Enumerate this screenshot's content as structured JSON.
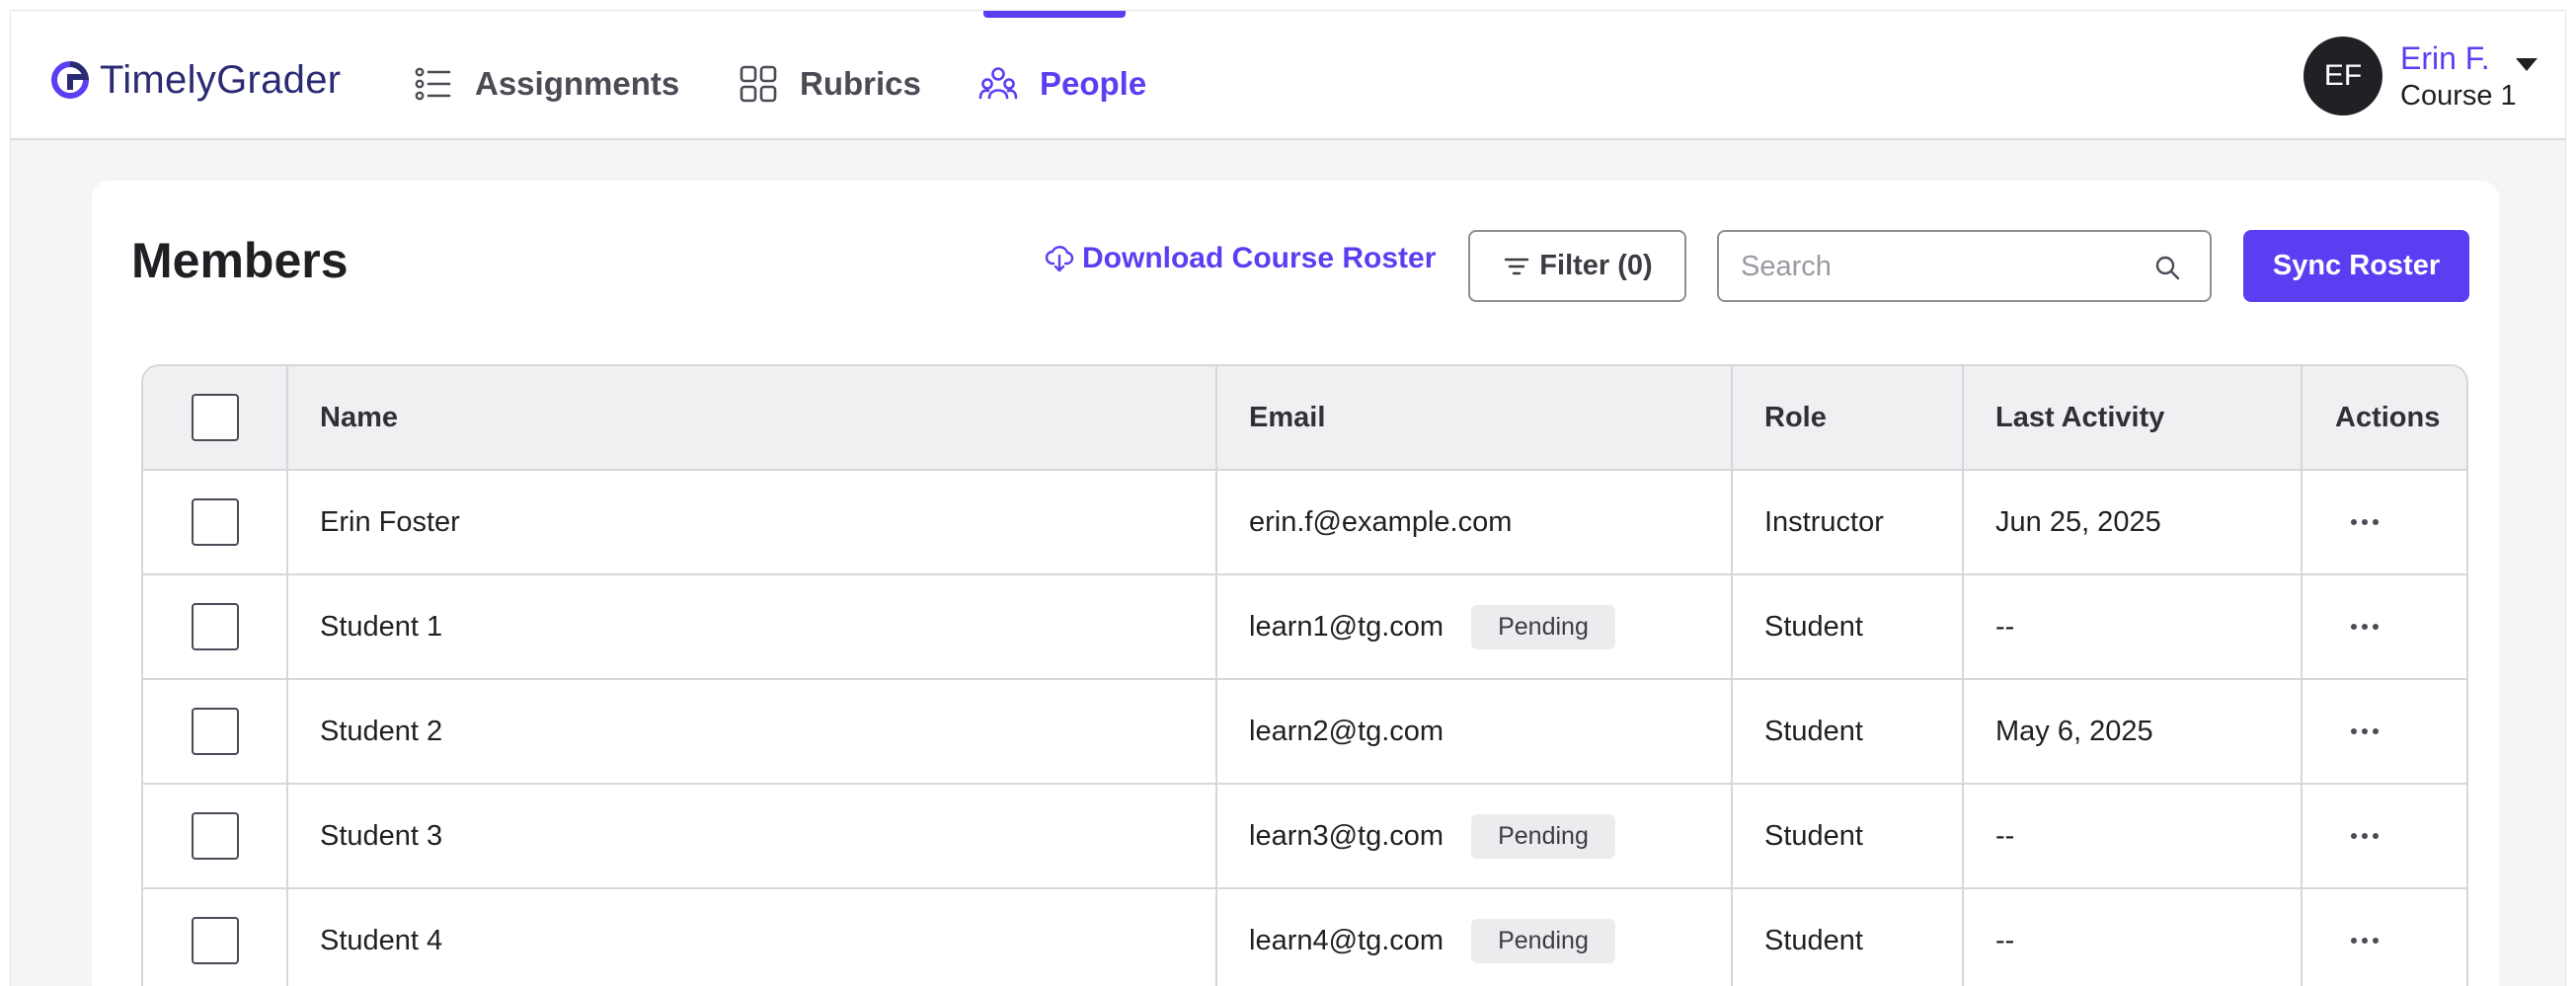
{
  "app": {
    "name": "TimelyGrader"
  },
  "nav": {
    "items": [
      {
        "label": "Assignments",
        "icon": "list-icon"
      },
      {
        "label": "Rubrics",
        "icon": "grid-icon"
      },
      {
        "label": "People",
        "icon": "people-icon",
        "active": true
      }
    ]
  },
  "user": {
    "initials": "EF",
    "name": "Erin F.",
    "course": "Course 1"
  },
  "members": {
    "title": "Members",
    "download_label": "Download Course Roster",
    "filter_label": "Filter (0)",
    "search_placeholder": "Search",
    "sync_label": "Sync Roster",
    "columns": [
      "Name",
      "Email",
      "Role",
      "Last Activity",
      "Actions"
    ],
    "rows": [
      {
        "name": "Erin Foster",
        "email": "erin.f@example.com",
        "badge": "",
        "role": "Instructor",
        "last_activity": "Jun 25, 2025"
      },
      {
        "name": "Student 1",
        "email": "learn1@tg.com",
        "badge": "Pending",
        "role": "Student",
        "last_activity": "--"
      },
      {
        "name": "Student 2",
        "email": "learn2@tg.com",
        "badge": "",
        "role": "Student",
        "last_activity": "May 6, 2025"
      },
      {
        "name": "Student 3",
        "email": "learn3@tg.com",
        "badge": "Pending",
        "role": "Student",
        "last_activity": "--"
      },
      {
        "name": "Student 4",
        "email": "learn4@tg.com",
        "badge": "Pending",
        "role": "Student",
        "last_activity": "--"
      }
    ]
  },
  "colors": {
    "accent": "#5a3ff2",
    "brand": "#2a2b72"
  }
}
